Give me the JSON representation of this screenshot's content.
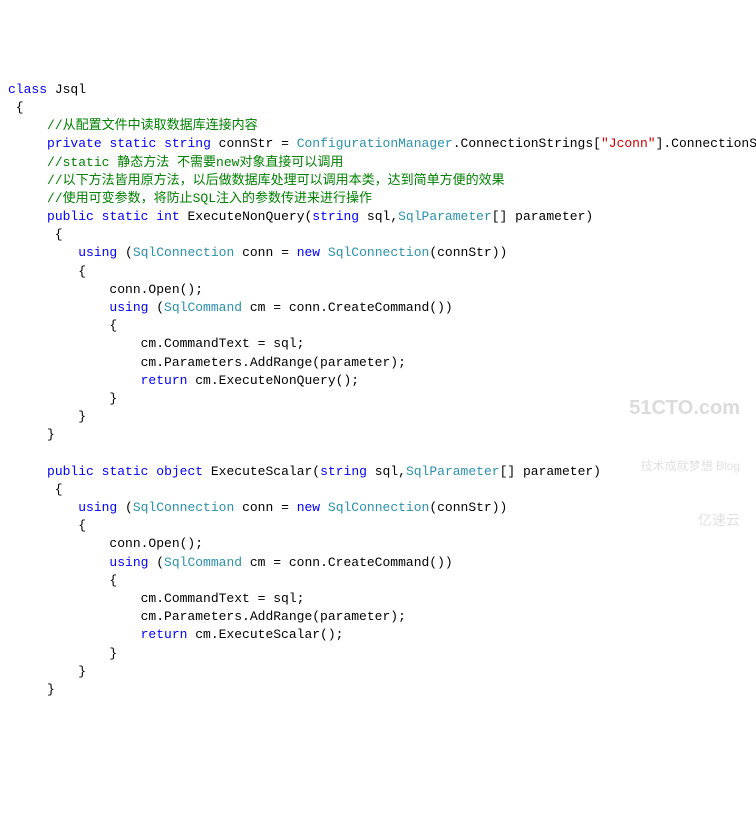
{
  "code": {
    "line01_kw1": "class",
    "line01_id": " Jsql",
    "line02": " {",
    "line03_indent": "     ",
    "line03_cmt": "//从配置文件中读取数据库连接内容",
    "line04_indent": "     ",
    "line04_kw1": "private",
    "line04_sp1": " ",
    "line04_kw2": "static",
    "line04_sp2": " ",
    "line04_kw3": "string",
    "line04_id1": " connStr = ",
    "line04_type": "ConfigurationManager",
    "line04_id2": ".ConnectionStrings[",
    "line04_str": "\"Jconn\"",
    "line04_id3": "].ConnectionString;",
    "line05_indent": "     ",
    "line05_cmt": "//static 静态方法 不需要new对象直接可以调用",
    "line06_indent": "     ",
    "line06_cmt": "//以下方法皆用原方法，以后做数据库处理可以调用本类，达到简单方便的效果",
    "line07_indent": "     ",
    "line07_cmt": "//使用可变参数，将防止SQL注入的参数传进来进行操作",
    "line08_indent": "     ",
    "line08_kw1": "public",
    "line08_sp1": " ",
    "line08_kw2": "static",
    "line08_sp2": " ",
    "line08_kw3": "int",
    "line08_id1": " ExecuteNonQuery(",
    "line08_kw4": "string",
    "line08_id2": " sql,",
    "line08_type": "SqlParameter",
    "line08_id3": "[] parameter)",
    "line09": "      {",
    "line10_indent": "         ",
    "line10_kw1": "using",
    "line10_id1": " (",
    "line10_type1": "SqlConnection",
    "line10_id2": " conn = ",
    "line10_kw2": "new",
    "line10_sp": " ",
    "line10_type2": "SqlConnection",
    "line10_id3": "(connStr))",
    "line11": "         {",
    "line12": "             conn.Open();",
    "line13_indent": "             ",
    "line13_kw1": "using",
    "line13_id1": " (",
    "line13_type": "SqlCommand",
    "line13_id2": " cm = conn.CreateCommand())",
    "line14": "             {",
    "line15": "                 cm.CommandText = sql;",
    "line16": "                 cm.Parameters.AddRange(parameter);",
    "line17_indent": "                 ",
    "line17_kw": "return",
    "line17_id": " cm.ExecuteNonQuery();",
    "line18": "             }",
    "line19": "         }",
    "line20": "     }",
    "line21": "",
    "line22_indent": "     ",
    "line22_kw1": "public",
    "line22_sp1": " ",
    "line22_kw2": "static",
    "line22_sp2": " ",
    "line22_kw3": "object",
    "line22_id1": " ExecuteScalar(",
    "line22_kw4": "string",
    "line22_id2": " sql,",
    "line22_type": "SqlParameter",
    "line22_id3": "[] parameter)",
    "line23": "      {",
    "line24_indent": "         ",
    "line24_kw1": "using",
    "line24_id1": " (",
    "line24_type1": "SqlConnection",
    "line24_id2": " conn = ",
    "line24_kw2": "new",
    "line24_sp": " ",
    "line24_type2": "SqlConnection",
    "line24_id3": "(connStr))",
    "line25": "         {",
    "line26": "             conn.Open();",
    "line27_indent": "             ",
    "line27_kw1": "using",
    "line27_id1": " (",
    "line27_type": "SqlCommand",
    "line27_id2": " cm = conn.CreateCommand())",
    "line28": "             {",
    "line29": "                 cm.CommandText = sql;",
    "line30": "                 cm.Parameters.AddRange(parameter);",
    "line31_indent": "                 ",
    "line31_kw": "return",
    "line31_id": " cm.ExecuteScalar();",
    "line32": "             }",
    "line33": "         }",
    "line34": "     }"
  },
  "watermark": {
    "w1": "51CTO.com",
    "w2": "技术成就梦想 Blog",
    "w3": "亿速云"
  }
}
